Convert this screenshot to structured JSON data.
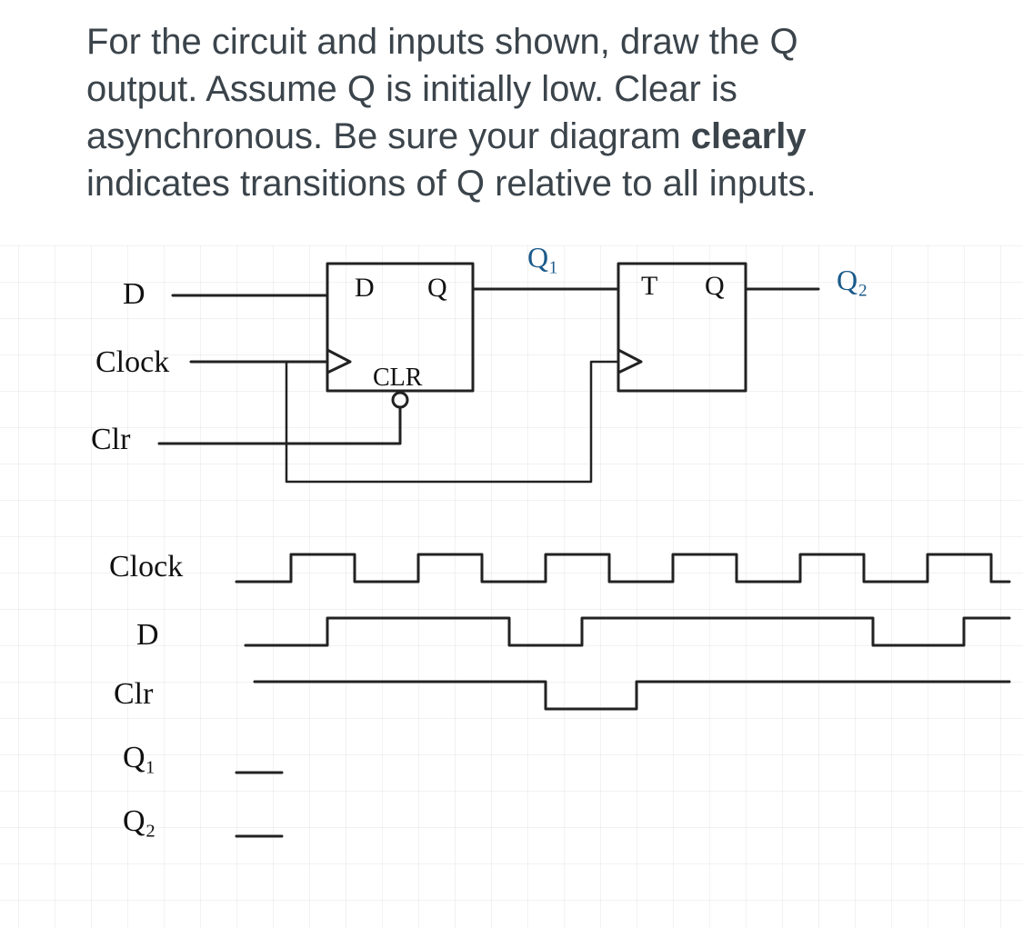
{
  "question": {
    "line1": "For the circuit and inputs shown, draw the Q",
    "line2": "output.  Assume Q is initially low.  Clear is",
    "line3_a": "asynchronous.  Be sure your diagram ",
    "line3_b": "clearly",
    "line4": "indicates transitions of Q relative to all inputs."
  },
  "circuit": {
    "input_labels": {
      "D": "D",
      "Clock": "Clock",
      "Clr": "Clr"
    },
    "ff1": {
      "D": "D",
      "Q": "Q",
      "CLR": "CLR",
      "out": "Q₁"
    },
    "ff2": {
      "T": "T",
      "Q": "Q",
      "out": "Q₂"
    }
  },
  "timing": {
    "labels": {
      "Clock": "Clock",
      "D": "D",
      "Clr": "Clr",
      "Q1": "Q₁",
      "Q2": "Q₂"
    }
  }
}
